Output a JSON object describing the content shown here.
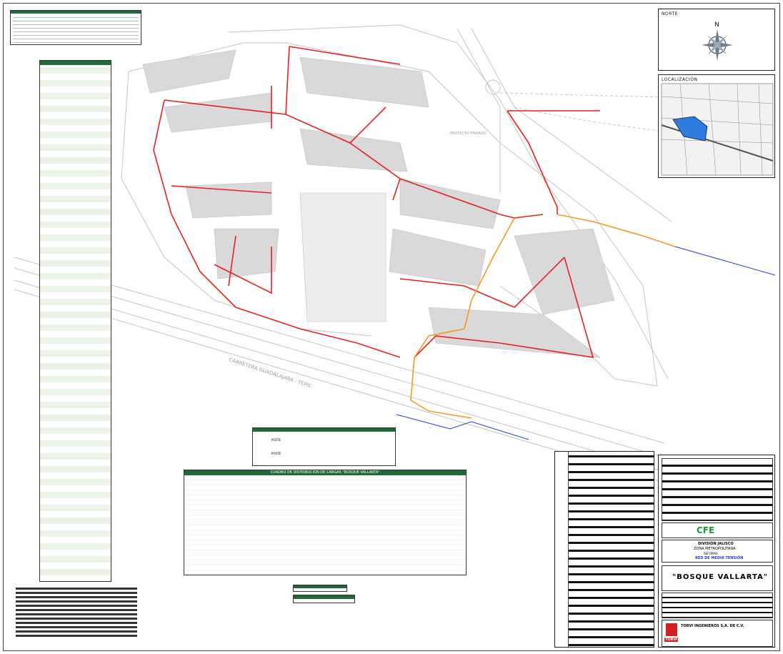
{
  "north_panel": {
    "title": "NORTE",
    "compass_letter": "N"
  },
  "location_panel": {
    "title": "LOCALIZACIÓN"
  },
  "map": {
    "road_label_main": "CARRETERA GUADALAJARA - TEPIC",
    "area_label": "PROYECTO PRIVADO"
  },
  "loads_table": {
    "title": "CUADRO DE DISTRIBUCIÓN DE CARGAS \"BOSQUE VALLARTA\""
  },
  "substation_table": {
    "rows": [
      "POSTE",
      "POSTE"
    ]
  },
  "title_block": {
    "company_logo": "CFE",
    "division": "DIVISIÓN JALISCO",
    "zone": "ZONA METROPOLITANA",
    "subzone": "REFORMA",
    "network": "RED DE MEDIA TENSIÓN",
    "project": "\"BOSQUE VALLARTA\"",
    "contractor": "TORVI INGENIEROS S.A. DE C.V.",
    "contractor_logo": "TORVI"
  },
  "colors": {
    "red_network": "#e8201e",
    "orange_network": "#f39a1e",
    "blue_network": "#2b3ad0",
    "table_green": "#1f6b36",
    "base_gray": "#b9b9b9"
  }
}
